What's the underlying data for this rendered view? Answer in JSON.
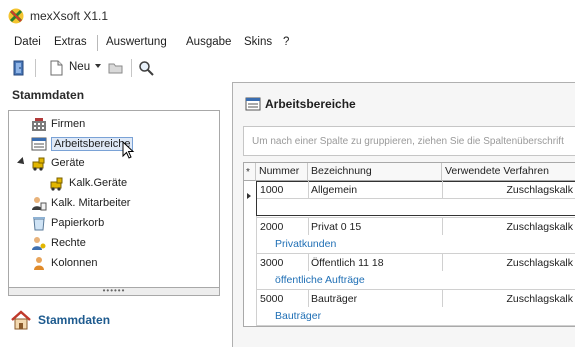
{
  "window": {
    "title": "mexXsoft X1.1"
  },
  "menu": {
    "items": [
      "Datei",
      "Extras",
      "Auswertung",
      "Ausgabe",
      "Skins",
      "?"
    ]
  },
  "toolbar": {
    "new_label": "Neu"
  },
  "left_panel": {
    "header": "Stammdaten",
    "tree": [
      {
        "label": "Firmen",
        "icon": "company-icon"
      },
      {
        "label": "Arbeitsbereiche",
        "icon": "workarea-icon",
        "selected": true
      },
      {
        "label": "Geräte",
        "icon": "devices-icon",
        "expanded": true
      },
      {
        "label": "Kalk.Geräte",
        "icon": "calc-devices-icon"
      },
      {
        "label": "Kalk. Mitarbeiter",
        "icon": "calc-staff-icon"
      },
      {
        "label": "Papierkorb",
        "icon": "trash-icon"
      },
      {
        "label": "Rechte",
        "icon": "rights-icon"
      },
      {
        "label": "Kolonnen",
        "icon": "team-icon"
      }
    ],
    "splitter_grip": "••••••",
    "bottom_nav_label": "Stammdaten"
  },
  "main": {
    "title": "Arbeitsbereiche",
    "group_hint": "Um nach einer Spalte zu gruppieren, ziehen Sie die Spaltenüberschrift",
    "new_row_marker": "*",
    "columns": [
      "Nummer",
      "Bezeichnung",
      "Verwendete Verfahren"
    ],
    "rows": [
      {
        "nummer": "1000",
        "bezeichnung": "Allgemein",
        "verfahren": "Zuschlagskalk",
        "detail": ""
      },
      {
        "nummer": "2000",
        "bezeichnung": "Privat 0 15",
        "verfahren": "Zuschlagskalk",
        "detail": "Privatkunden"
      },
      {
        "nummer": "3000",
        "bezeichnung": "Öffentlich 11 18",
        "verfahren": "Zuschlagskalk",
        "detail": "öffentliche Aufträge"
      },
      {
        "nummer": "5000",
        "bezeichnung": "Bauträger",
        "verfahren": "Zuschlagskalk",
        "detail": "Bauträger"
      }
    ]
  },
  "colors": {
    "accent": "#1d5a8e",
    "link": "#1f6fb5",
    "selection": "#dfe9f7"
  }
}
